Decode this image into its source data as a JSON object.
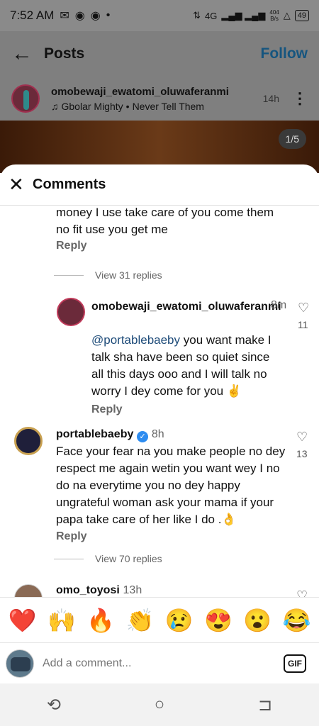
{
  "status_bar": {
    "time": "7:52 AM",
    "net_speed_top": "404",
    "net_speed_bottom": "B/s",
    "network": "4G",
    "battery": "49"
  },
  "post_header": {
    "title": "Posts",
    "follow_label": "Follow"
  },
  "author": {
    "name": "omobewaji_ewatomi_oluwaferanmi",
    "song": "Gbolar Mighty",
    "song_title": "Never Tell Them",
    "time": "14h"
  },
  "image_counter": "1/5",
  "sheet": {
    "title": "Comments"
  },
  "comments": [
    {
      "text": "money I use take care of you come them no fit use you get me",
      "reply_label": "Reply",
      "view_replies": "View 31 replies"
    },
    {
      "user": "omobewaji_ewatomi_oluwaferanmi",
      "time": "8m",
      "mention": "@portablebaeby",
      "text": " you want make I talk sha have been so quiet since all this days ooo and I will talk no worry I dey come for you ✌️",
      "likes": "11",
      "reply_label": "Reply"
    },
    {
      "user": "portablebaeby",
      "time": "8h",
      "text": "Face your fear na you make people no dey respect me again wetin you want wey I no do na everytime you no dey happy ungrateful woman ask your mama if your papa take care of her like I do .👌",
      "likes": "13",
      "reply_label": "Reply",
      "view_replies": "View 70 replies"
    },
    {
      "user": "omo_toyosi",
      "time": "13h"
    }
  ],
  "emojis": [
    "❤️",
    "🙌",
    "🔥",
    "👏",
    "😢",
    "😍",
    "😮",
    "😂"
  ],
  "composer": {
    "placeholder": "Add a comment...",
    "gif_label": "GIF"
  },
  "nav_icons": [
    "recents-icon",
    "home-icon",
    "back-icon"
  ]
}
